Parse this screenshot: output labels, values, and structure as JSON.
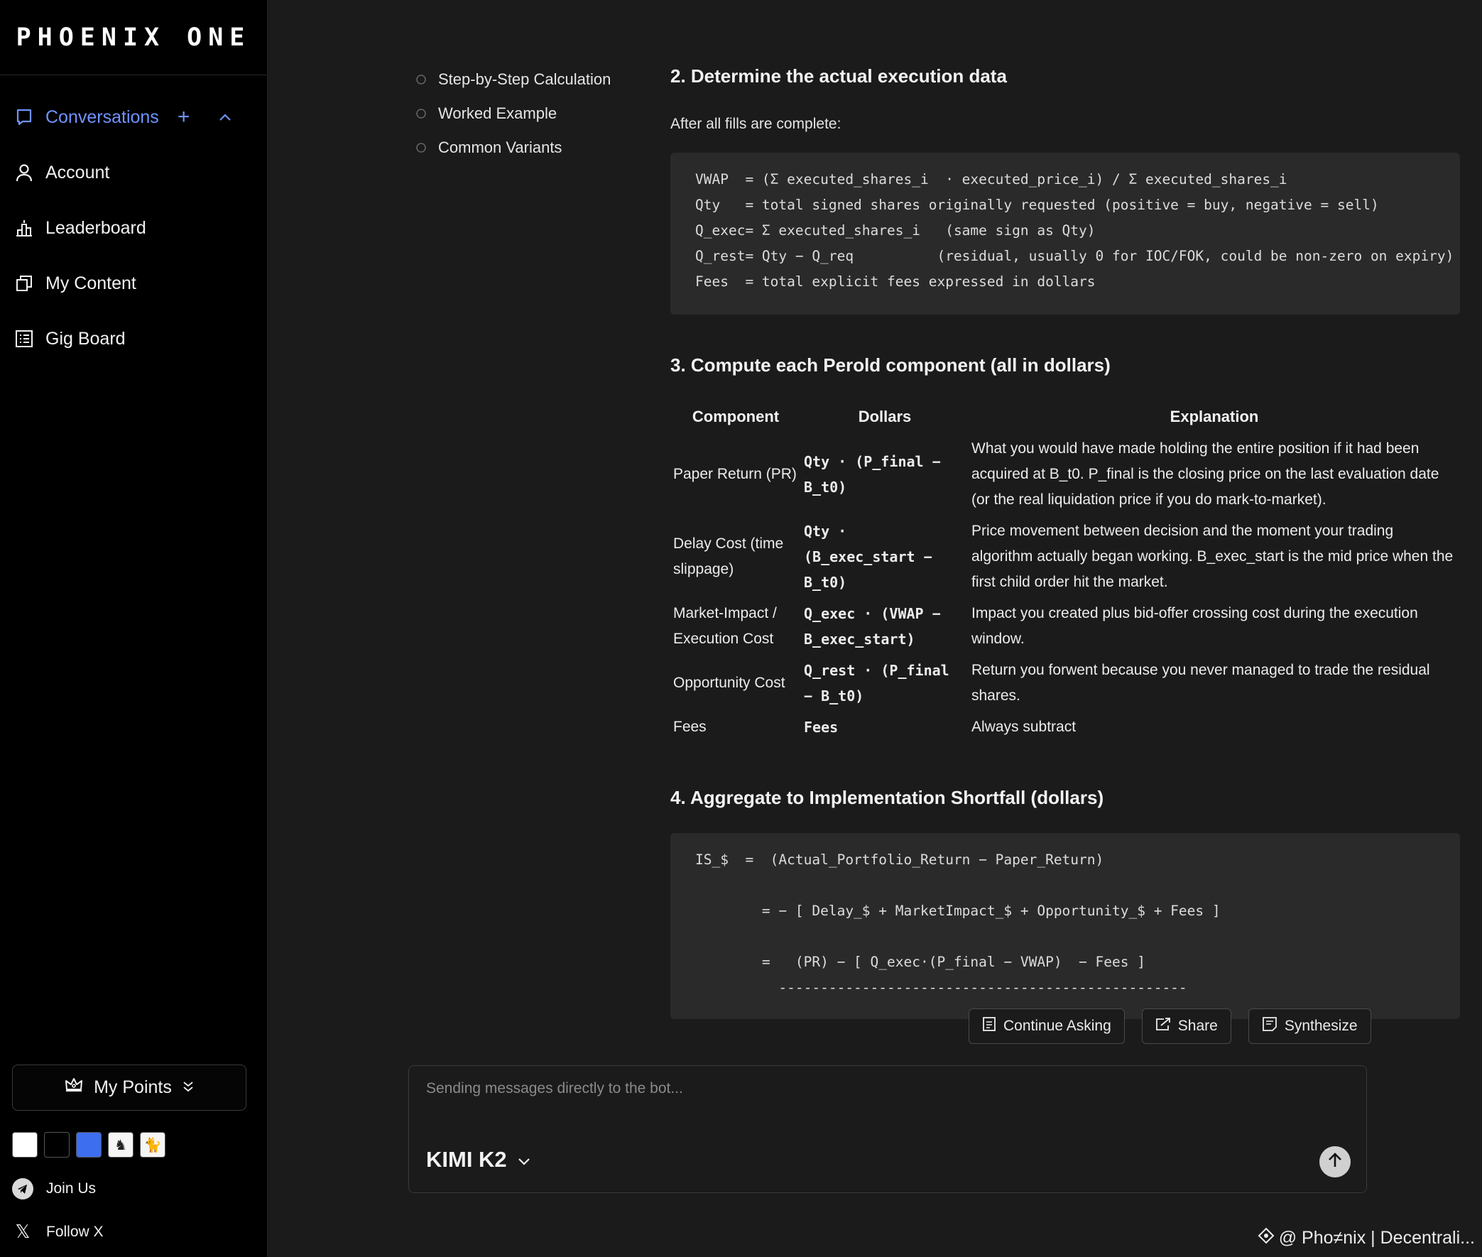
{
  "brand": "PHOENIX ONE",
  "sidebar": {
    "items": [
      {
        "label": "Conversations",
        "icon": "chat-icon"
      },
      {
        "label": "Account",
        "icon": "user-icon"
      },
      {
        "label": "Leaderboard",
        "icon": "podium-icon"
      },
      {
        "label": "My Content",
        "icon": "copy-icon"
      },
      {
        "label": "Gig Board",
        "icon": "list-icon"
      }
    ],
    "points_label": "My Points",
    "join_label": "Join Us",
    "follow_label": "Follow X"
  },
  "toc": {
    "items": [
      "Step-by-Step Calculation",
      "Worked Example",
      "Common Variants"
    ]
  },
  "section2": {
    "title": "2. Determine the actual execution data",
    "intro": "After all fills are complete:",
    "code": "VWAP  = (Σ executed_shares_i  · executed_price_i) / Σ executed_shares_i\nQty   = total signed shares originally requested (positive = buy, negative = sell)\nQ_exec= Σ executed_shares_i   (same sign as Qty)\nQ_rest= Qty − Q_req          (residual, usually 0 for IOC/FOK, could be non-zero on expiry)\nFees  = total explicit fees expressed in dollars"
  },
  "section3": {
    "title": "3. Compute each Perold component (all in dollars)",
    "headers": [
      "Component",
      "Dollars",
      "Explanation"
    ],
    "rows": [
      {
        "component": "Paper Return (PR)",
        "dollars": "Qty · (P_final − B_t0)",
        "explanation": "What you would have made holding the entire position if it had been acquired at B_t0. P_final is the closing price on the last evaluation date (or the real liquidation price if you do mark-to-market)."
      },
      {
        "component": "Delay Cost (time slippage)",
        "dollars": "Qty · (B_exec_start − B_t0)",
        "explanation": "Price movement between decision and the moment your trading algorithm actually began working. B_exec_start is the mid price when the first child order hit the market."
      },
      {
        "component": "Market-Impact / Execution Cost",
        "dollars": "Q_exec · (VWAP − B_exec_start)",
        "explanation": "Impact you created plus bid-offer crossing cost during the execution window."
      },
      {
        "component": "Opportunity Cost",
        "dollars": "Q_rest · (P_final − B_t0)",
        "explanation": "Return you forwent because you never managed to trade the residual shares."
      },
      {
        "component": "Fees",
        "dollars": "Fees",
        "explanation": "Always subtract"
      }
    ]
  },
  "section4": {
    "title": "4. Aggregate to Implementation Shortfall (dollars)",
    "code": "IS_$  =  (Actual_Portfolio_Return − Paper_Return)\n\n        = − [ Delay_$ + MarketImpact_$ + Opportunity_$ + Fees ]\n\n        =   (PR) − [ Q_exec·(P_final − VWAP)  − Fees ]\n          -------------------------------------------------"
  },
  "actions": {
    "continue": "Continue Asking",
    "share": "Share",
    "synthesize": "Synthesize"
  },
  "composer": {
    "placeholder": "Sending messages directly to the bot...",
    "model": "KIMI K2"
  },
  "footer": "@ Pho≠nix | Decentrali..."
}
